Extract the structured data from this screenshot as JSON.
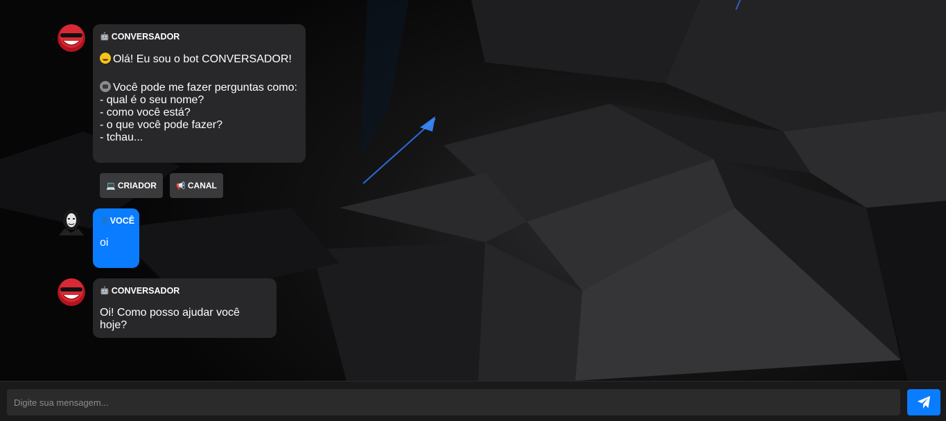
{
  "messages": [
    {
      "sender_icon": "robot-emoji",
      "sender": "CONVERSADOR",
      "lines": [
        {
          "emoji": "grinning-face",
          "text": "Olá! Eu sou o bot CONVERSADOR!"
        },
        {
          "emoji": "robot-face",
          "text": "Você pode me fazer perguntas como:"
        }
      ],
      "list": "- qual é o seu nome?\n- como você está?\n- o que você pode fazer?\n- tchau..."
    },
    {
      "sender_icon": "user-silhouette",
      "sender": "VOCÊ",
      "text": "oi"
    },
    {
      "sender_icon": "robot-emoji",
      "sender": "CONVERSADOR",
      "text": "Oi! Como posso ajudar você hoje?"
    }
  ],
  "quick_buttons": [
    {
      "icon": "laptop-icon",
      "label": "CRIADOR"
    },
    {
      "icon": "megaphone-icon",
      "label": "CANAL"
    }
  ],
  "composer": {
    "placeholder": "Digite sua mensagem...",
    "send_icon": "paper-plane-icon"
  },
  "colors": {
    "accent": "#0a7cff",
    "bot_bubble": "#2a2a2c",
    "footer": "#1a1a1a"
  }
}
